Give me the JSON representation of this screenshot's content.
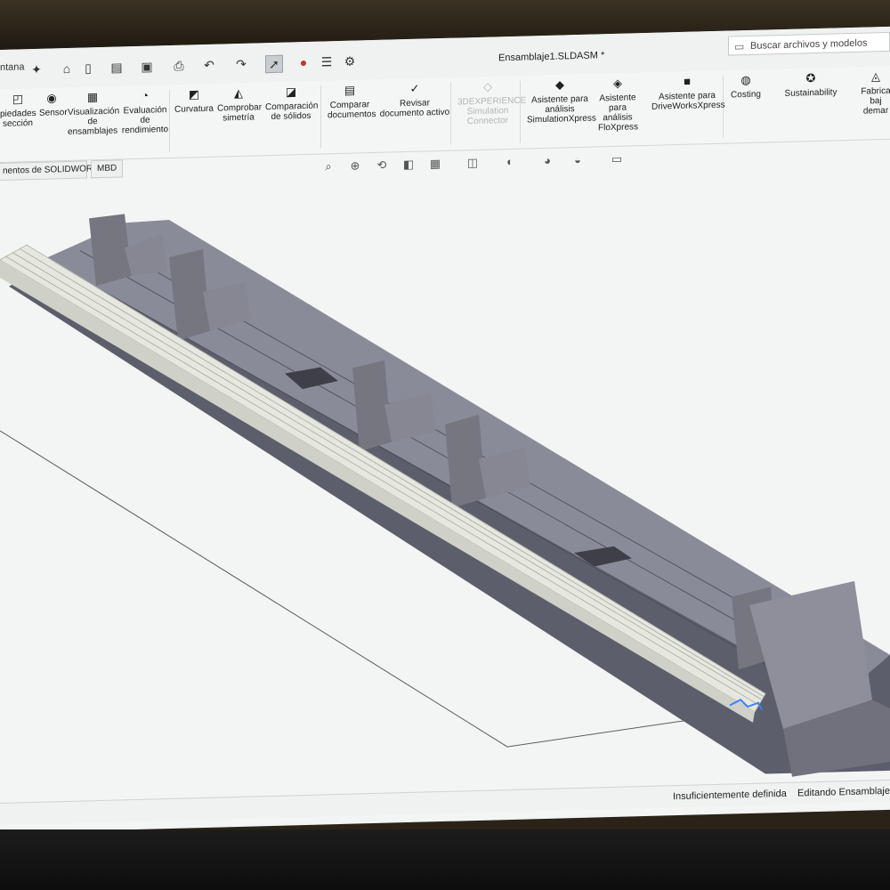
{
  "window": {
    "document_title": "Ensamblaje1.SLDASM *",
    "menu_fragment": "ntana",
    "search_placeholder": "Buscar archivos y modelos"
  },
  "ribbon": {
    "items": [
      {
        "label": "piedades\nsección",
        "icon": "section-properties-icon",
        "enabled": true
      },
      {
        "label": "Sensor",
        "icon": "sensor-icon",
        "enabled": true
      },
      {
        "label": "Visualización\nde\nensamblajes",
        "icon": "assembly-visualization-icon",
        "enabled": true
      },
      {
        "label": "Evaluación\nde\nrendimiento",
        "icon": "performance-evaluation-icon",
        "enabled": true
      },
      {
        "label": "Curvatura",
        "icon": "curvature-icon",
        "enabled": true
      },
      {
        "label": "Comprobar\nsimetría",
        "icon": "symmetry-check-icon",
        "enabled": true
      },
      {
        "label": "Comparación\nde sólidos",
        "icon": "compare-solids-icon",
        "enabled": true
      },
      {
        "label": "Comparar\ndocumentos",
        "icon": "compare-documents-icon",
        "enabled": true
      },
      {
        "label": "Revisar\ndocumento activo",
        "icon": "check-active-document-icon",
        "enabled": true
      },
      {
        "label": "3DEXPERIENCE\nSimulation\nConnector",
        "icon": "simulation-connector-icon",
        "enabled": false
      },
      {
        "label": "Asistente para\nanálisis\nSimulationXpress",
        "icon": "simulationxpress-icon",
        "enabled": true
      },
      {
        "label": "Asistente\npara\nanálisis\nFloXpress",
        "icon": "floxpress-icon",
        "enabled": true
      },
      {
        "label": "Asistente para\nDriveWorksXpress",
        "icon": "driveworksxpress-icon",
        "enabled": true
      },
      {
        "label": "Costing",
        "icon": "costing-icon",
        "enabled": true
      },
      {
        "label": "Sustainability",
        "icon": "sustainability-icon",
        "enabled": true
      },
      {
        "label": "Fabrica\nbaj\ndemar",
        "icon": "manufacturing-icon",
        "enabled": true
      }
    ]
  },
  "tabs": [
    {
      "label": "nentos de SOLIDWORKS"
    },
    {
      "label": "MBD"
    }
  ],
  "status": {
    "definition": "Insuficientemente definida",
    "mode": "Editando Ensamblaje"
  },
  "colors": {
    "part_top": "#8a8b99",
    "part_side": "#5d5e6b",
    "rail": "#e4e6de",
    "background": "#f3f5f4"
  }
}
